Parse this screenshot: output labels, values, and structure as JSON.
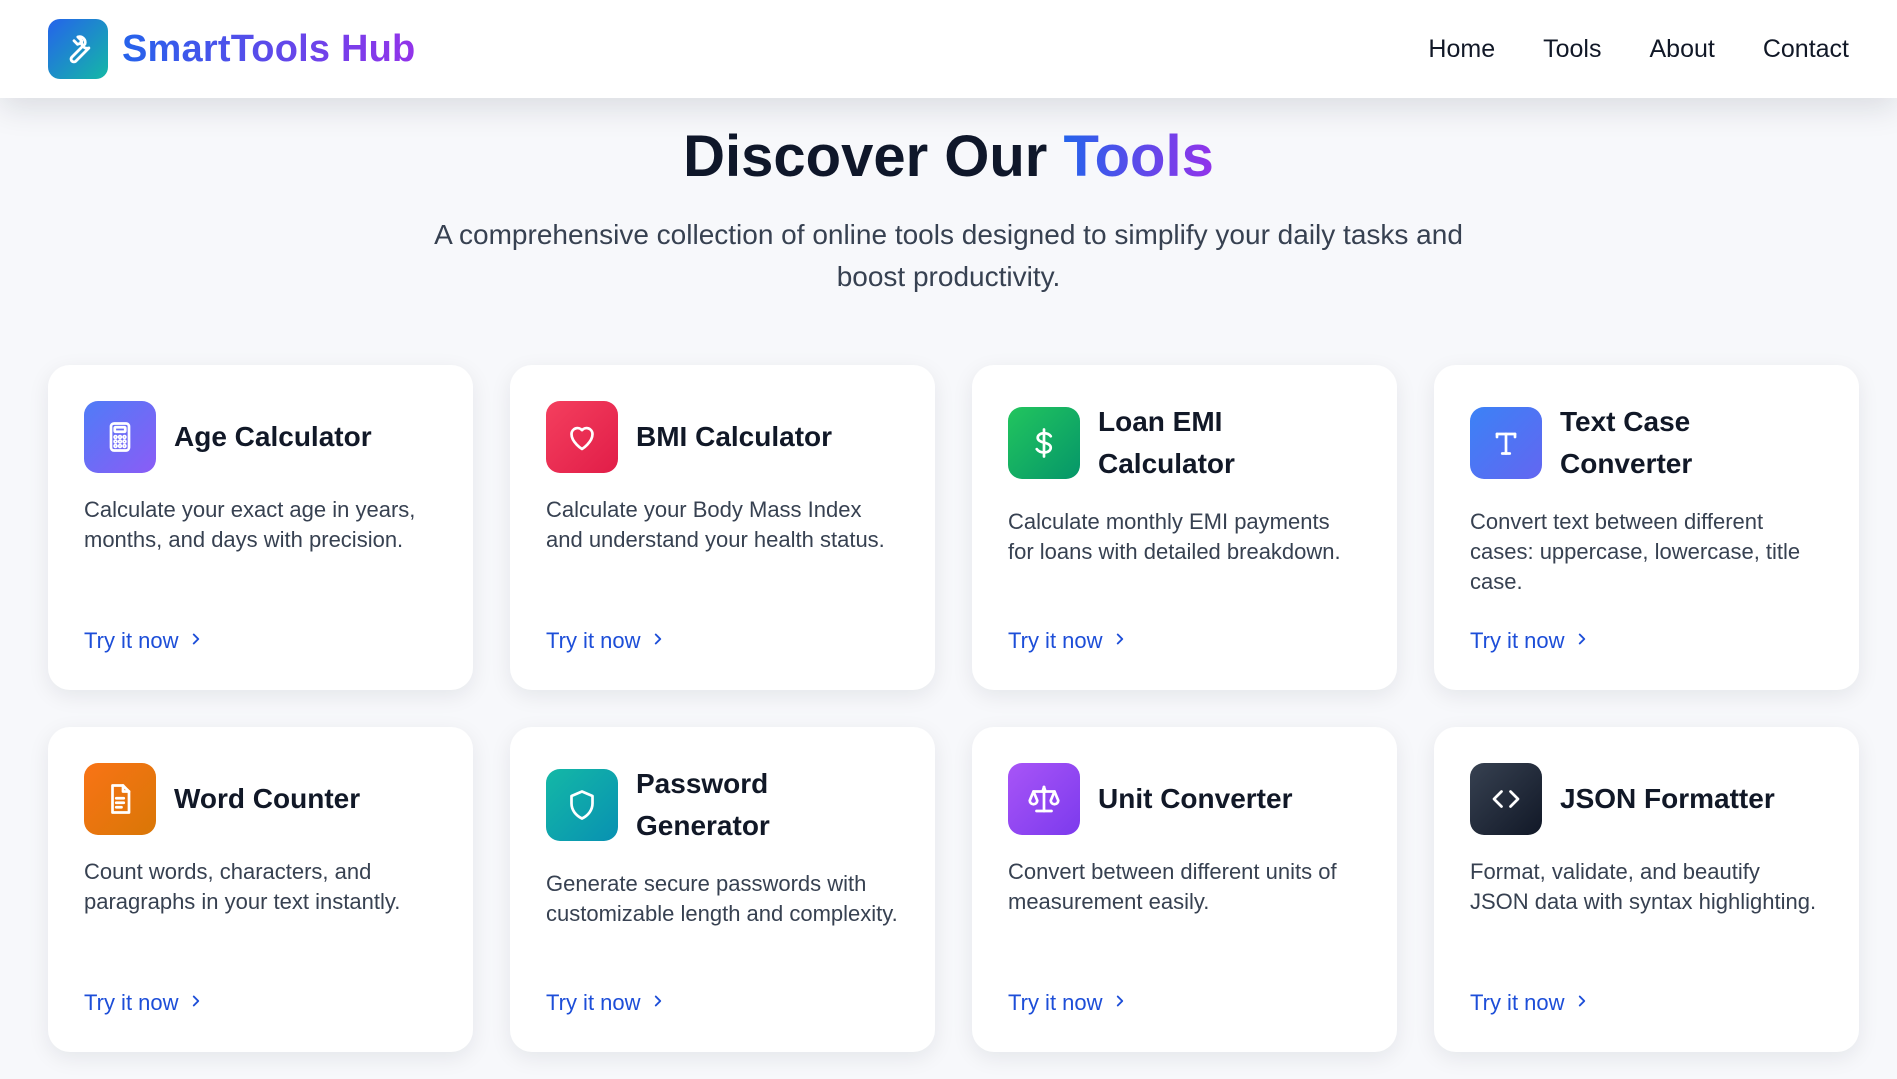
{
  "header": {
    "brand_name": "SmartTools Hub",
    "nav": [
      {
        "label": "Home"
      },
      {
        "label": "Tools"
      },
      {
        "label": "About"
      },
      {
        "label": "Contact"
      }
    ]
  },
  "hero": {
    "title_main": "Discover Our ",
    "title_accent": "Tools",
    "subtitle": "A comprehensive collection of online tools designed to simplify your daily tasks and boost productivity."
  },
  "tools": [
    {
      "title": "Age Calculator",
      "description": "Calculate your exact age in years, months, and days with precision.",
      "link": "Try it now",
      "icon": "calculator-icon",
      "colors": [
        "#4f7cf7",
        "#8b5cf6"
      ]
    },
    {
      "title": "BMI Calculator",
      "description": "Calculate your Body Mass Index and understand your health status.",
      "link": "Try it now",
      "icon": "heart-icon",
      "colors": [
        "#f43f5e",
        "#e11d48"
      ]
    },
    {
      "title": "Loan EMI Calculator",
      "description": "Calculate monthly EMI payments for loans with detailed breakdown.",
      "link": "Try it now",
      "icon": "dollar-icon",
      "colors": [
        "#22c55e",
        "#059669"
      ]
    },
    {
      "title": "Text Case Converter",
      "description": "Convert text between different cases: uppercase, lowercase, title case.",
      "link": "Try it now",
      "icon": "text-t-icon",
      "colors": [
        "#3b82f6",
        "#6366f1"
      ]
    },
    {
      "title": "Word Counter",
      "description": "Count words, characters, and paragraphs in your text instantly.",
      "link": "Try it now",
      "icon": "document-icon",
      "colors": [
        "#f97316",
        "#d97706"
      ]
    },
    {
      "title": "Password Generator",
      "description": "Generate secure passwords with customizable length and complexity.",
      "link": "Try it now",
      "icon": "shield-icon",
      "colors": [
        "#14b8a6",
        "#0891b2"
      ]
    },
    {
      "title": "Unit Converter",
      "description": "Convert between different units of measurement easily.",
      "link": "Try it now",
      "icon": "scale-icon",
      "colors": [
        "#a855f7",
        "#7c3aed"
      ]
    },
    {
      "title": "JSON Formatter",
      "description": "Format, validate, and beautify JSON data with syntax highlighting.",
      "link": "Try it now",
      "icon": "code-brackets-icon",
      "colors": [
        "#374151",
        "#111827"
      ]
    }
  ],
  "colors": {
    "brand_gradient_start": "#2563eb",
    "brand_gradient_end": "#9333ea",
    "link": "#1d4ed8"
  }
}
